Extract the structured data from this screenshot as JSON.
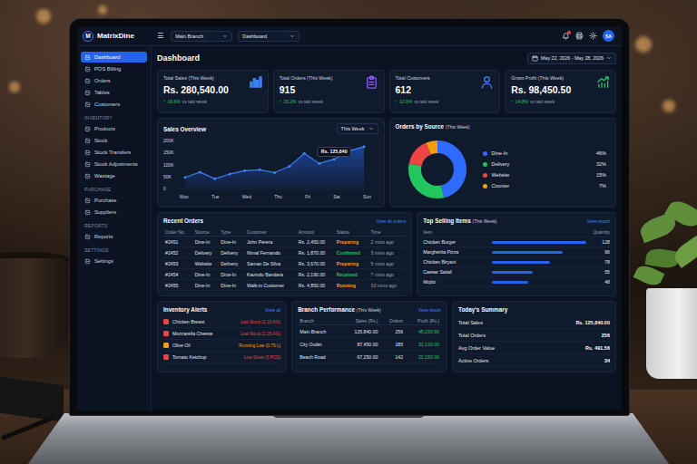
{
  "header": {
    "logo_letter": "M",
    "brand": "MatrixDine",
    "menu_glyph": "☰",
    "branch": "Main Branch",
    "page_select": "Dashboard",
    "notifications_unread": true,
    "avatar": "SA"
  },
  "sidebar": {
    "items": [
      {
        "label": "Dashboard",
        "selected": true
      },
      {
        "label": "POS Billing",
        "selected": false
      },
      {
        "label": "Orders",
        "selected": false
      },
      {
        "label": "Tables",
        "selected": false
      },
      {
        "label": "Customers",
        "selected": false
      }
    ],
    "sections": [
      {
        "heading": "INVENTORY",
        "items": [
          {
            "label": "Products",
            "selected": false
          },
          {
            "label": "Stock",
            "selected": false
          },
          {
            "label": "Stock Transfers",
            "selected": false
          },
          {
            "label": "Stock Adjustments",
            "selected": false
          },
          {
            "label": "Wastage",
            "selected": false
          }
        ]
      },
      {
        "heading": "PURCHASE",
        "items": [
          {
            "label": "Purchase",
            "selected": false
          },
          {
            "label": "Suppliers",
            "selected": false
          }
        ]
      },
      {
        "heading": "REPORTS",
        "items": [
          {
            "label": "Reports",
            "selected": false
          }
        ]
      },
      {
        "heading": "SETTINGS",
        "items": [
          {
            "label": "Settings",
            "selected": false
          }
        ]
      }
    ]
  },
  "page": {
    "title": "Dashboard",
    "date_range": "May 22, 2026 - May 28, 2026"
  },
  "stats": [
    {
      "label": "Total Sales (This Week)",
      "value": "Rs. 280,540.00",
      "trend_glyph": "↑",
      "change": "18.6%",
      "suffix": "vs last week"
    },
    {
      "label": "Total Orders (This Week)",
      "value": "915",
      "trend_glyph": "↑",
      "change": "15.2%",
      "suffix": "vs last week"
    },
    {
      "label": "Total Customers",
      "value": "612",
      "trend_glyph": "↑",
      "change": "12.6%",
      "suffix": "vs last week"
    },
    {
      "label": "Gross Profit (This Week)",
      "value": "Rs. 98,450.50",
      "trend_glyph": "↑",
      "change": "14.8%",
      "suffix": "vs last week"
    }
  ],
  "sales_chart": {
    "title": "Sales Overview",
    "period": "This Week",
    "y_max": 200000,
    "y_ticks": [
      "200K",
      "150K",
      "100K",
      "50K",
      "0"
    ],
    "x_labels": [
      "Mon",
      "Tue",
      "Wed",
      "Thu",
      "Fri",
      "Sat",
      "Sun"
    ],
    "series": [
      {
        "values": [
          50000,
          72000,
          44000,
          64000,
          78000,
          82000,
          70000,
          96000,
          150000,
          108000,
          125840,
          160000,
          178000
        ]
      }
    ],
    "tooltip": {
      "text": "Rs. 125,840",
      "index": 10
    }
  },
  "orders_by_source": {
    "title": "Orders by Source",
    "subtitle": "(This Week)",
    "sources": [
      {
        "label": "Dine-In",
        "percent": "46%",
        "share": 0.46,
        "color": "#2f6bff"
      },
      {
        "label": "Delivery",
        "percent": "32%",
        "share": 0.32,
        "color": "#22c55e"
      },
      {
        "label": "Website",
        "percent": "15%",
        "share": 0.15,
        "color": "#ef4444"
      },
      {
        "label": "Counter",
        "percent": "7%",
        "share": 0.07,
        "color": "#f59e0b"
      }
    ]
  },
  "recent_orders": {
    "title": "Recent Orders",
    "link": "View all orders",
    "columns": [
      "Order No.",
      "Source",
      "Type",
      "Customer",
      "Amount",
      "Status",
      "Time"
    ],
    "rows": [
      {
        "cells": [
          "#2451",
          "Dine-In",
          "Dine-In",
          "John Perera",
          "Rs. 2,450.00",
          "Preparing",
          "2 mins ago"
        ],
        "color": "#f59e0b"
      },
      {
        "cells": [
          "#2452",
          "Delivery",
          "Delivery",
          "Nimal Fernando",
          "Rs. 1,870.00",
          "Confirmed",
          "3 mins ago"
        ],
        "color": "#22c55e"
      },
      {
        "cells": [
          "#2453",
          "Website",
          "Delivery",
          "Saman De Silva",
          "Rs. 3,670.00",
          "Preparing",
          "5 mins ago"
        ],
        "color": "#f59e0b"
      },
      {
        "cells": [
          "#2454",
          "Dine-In",
          "Dine-In",
          "Kavindu Bandara",
          "Rs. 2,190.00",
          "Received",
          "7 mins ago"
        ],
        "color": "#22c55e"
      },
      {
        "cells": [
          "#2455",
          "Dine-In",
          "Dine-In",
          "Walk-in Customer",
          "Rs. 4,850.00",
          "Running",
          "10 mins ago"
        ],
        "color": "#f59e0b"
      }
    ]
  },
  "top_selling": {
    "title": "Top Selling Items",
    "subtitle": "(This Week)",
    "link": "View report",
    "columns": [
      "Item",
      "Quantity"
    ],
    "items": [
      {
        "name": "Chicken Burger",
        "quantity": "128",
        "level": 1.0
      },
      {
        "name": "Margherita Pizza",
        "quantity": "96",
        "level": 0.75
      },
      {
        "name": "Chicken Biryani",
        "quantity": "78",
        "level": 0.61
      },
      {
        "name": "Caesar Salad",
        "quantity": "55",
        "level": 0.43
      },
      {
        "name": "Mojito",
        "quantity": "48",
        "level": 0.38
      }
    ]
  },
  "inventory_alerts": {
    "title": "Inventory Alerts",
    "link": "View all",
    "items": [
      {
        "name": "Chicken Breast",
        "status": "Low Stock (2.10 KG)",
        "color": "#ef4444"
      },
      {
        "name": "Mozzarella Cheese",
        "status": "Low Stock (1.25 KG)",
        "color": "#ef4444"
      },
      {
        "name": "Olive Oil",
        "status": "Running Low (0.75 L)",
        "color": "#f59e0b"
      },
      {
        "name": "Tomato Ketchup",
        "status": "Low Stock (5 PCS)",
        "color": "#ef4444"
      }
    ]
  },
  "branch_performance": {
    "title": "Branch Performance",
    "subtitle": "(This Week)",
    "link": "View report",
    "columns": [
      "Branch",
      "Sales (Rs.)",
      "Orders",
      "Profit (Rs.)"
    ],
    "rows": [
      [
        "Main Branch",
        "125,840.00",
        "256",
        "45,230.50"
      ],
      [
        "City Outlet",
        "87,450.00",
        "185",
        "31,130.00"
      ],
      [
        "Beach Road",
        "67,250.00",
        "142",
        "22,150.00"
      ]
    ]
  },
  "todays_summary": {
    "title": "Today's Summary",
    "rows": [
      {
        "label": "Total Sales",
        "value": "Rs. 125,840.00"
      },
      {
        "label": "Total Orders",
        "value": "256"
      },
      {
        "label": "Avg Order Value",
        "value": "Rs. 491.56"
      },
      {
        "label": "Active Orders",
        "value": "34"
      }
    ]
  }
}
